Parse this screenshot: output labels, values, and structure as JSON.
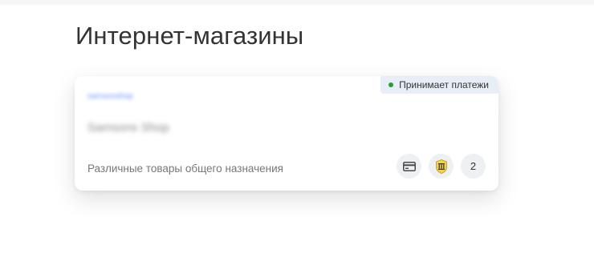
{
  "page": {
    "title": "Интернет-магазины"
  },
  "shop_card": {
    "status_badge": "Принимает платежи",
    "status_color": "#21a038",
    "link_text": "samsonshop",
    "shop_name": "Samsons Shop",
    "description": "Различные товары общего назначения",
    "payment_icons": [
      "card-icon",
      "bank-logo-icon"
    ],
    "extra_count": "2"
  }
}
